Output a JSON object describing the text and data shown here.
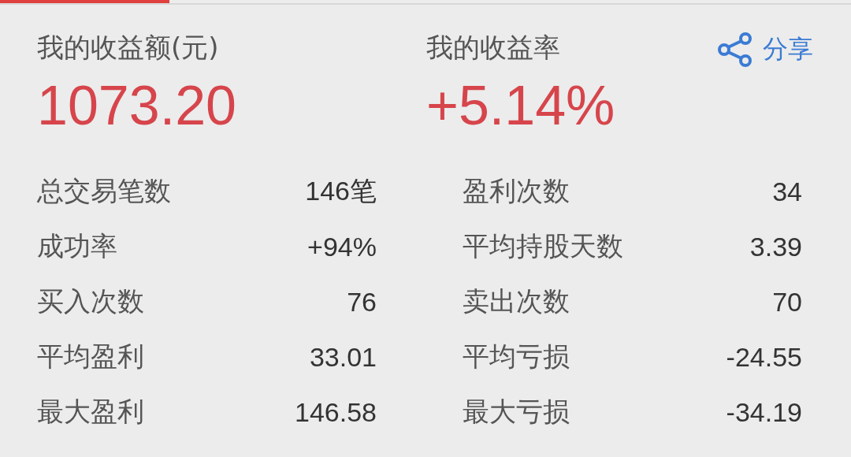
{
  "summary": [
    {
      "label": "我的收益额(元)",
      "value": "1073.20"
    },
    {
      "label": "我的收益率",
      "value": "+5.14%"
    }
  ],
  "share": {
    "label": "分享"
  },
  "stats": [
    [
      {
        "label": "总交易笔数",
        "value": "146笔"
      },
      {
        "label": "盈利次数",
        "value": "34"
      }
    ],
    [
      {
        "label": "成功率",
        "value": "+94%"
      },
      {
        "label": "平均持股天数",
        "value": "3.39"
      }
    ],
    [
      {
        "label": "买入次数",
        "value": "76"
      },
      {
        "label": "卖出次数",
        "value": "70"
      }
    ],
    [
      {
        "label": "平均盈利",
        "value": "33.01"
      },
      {
        "label": "平均亏损",
        "value": "-24.55"
      }
    ],
    [
      {
        "label": "最大盈利",
        "value": "146.58"
      },
      {
        "label": "最大亏损",
        "value": "-34.19"
      }
    ]
  ]
}
